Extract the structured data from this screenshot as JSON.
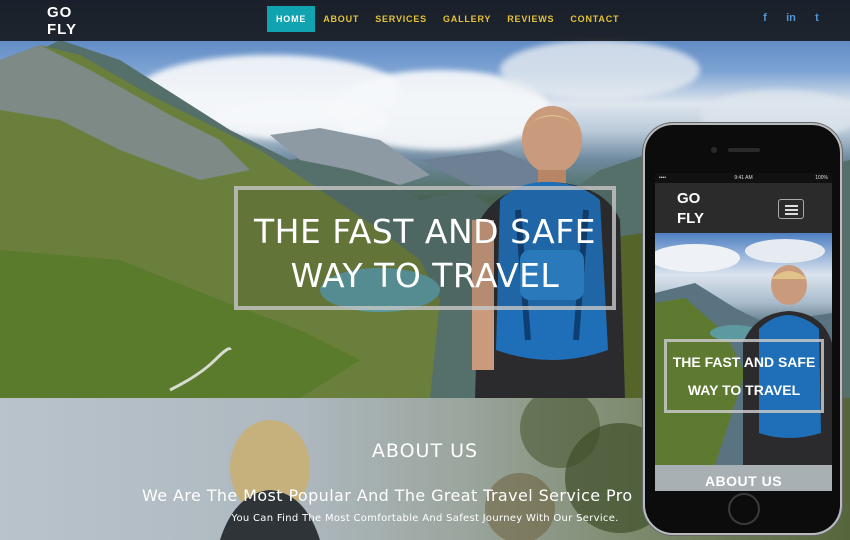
{
  "brand": {
    "logo_line1": "GO",
    "logo_line2": "FLY"
  },
  "nav": {
    "items": [
      {
        "label": "HOME",
        "active": true
      },
      {
        "label": "ABOUT",
        "active": false
      },
      {
        "label": "SERVICES",
        "active": false
      },
      {
        "label": "GALLERY",
        "active": false
      },
      {
        "label": "REVIEWS",
        "active": false
      },
      {
        "label": "CONTACT",
        "active": false
      }
    ],
    "active_color": "#11a4b0",
    "link_color": "#e4c23a"
  },
  "social": [
    {
      "icon": "facebook-icon",
      "glyph": "f"
    },
    {
      "icon": "linkedin-icon",
      "glyph": "in"
    },
    {
      "icon": "twitter-icon",
      "glyph": "t"
    }
  ],
  "hero": {
    "title_line1": "THE FAST AND SAFE",
    "title_line2": "WAY TO TRAVEL"
  },
  "about": {
    "heading": "ABOUT US",
    "subheading": "We Are The Most Popular And The Great Travel Service Pro",
    "text": "You Can Find The Most Comfortable And Safest Journey With Our Service."
  },
  "mobile": {
    "status_time": "9:41 AM",
    "status_battery": "100%",
    "status_signal": "•••• ",
    "logo_line1": "GO",
    "logo_line2": "FLY",
    "hero_line1": "THE FAST AND SAFE",
    "hero_line2": "WAY TO TRAVEL",
    "about_heading": "ABOUT US"
  }
}
